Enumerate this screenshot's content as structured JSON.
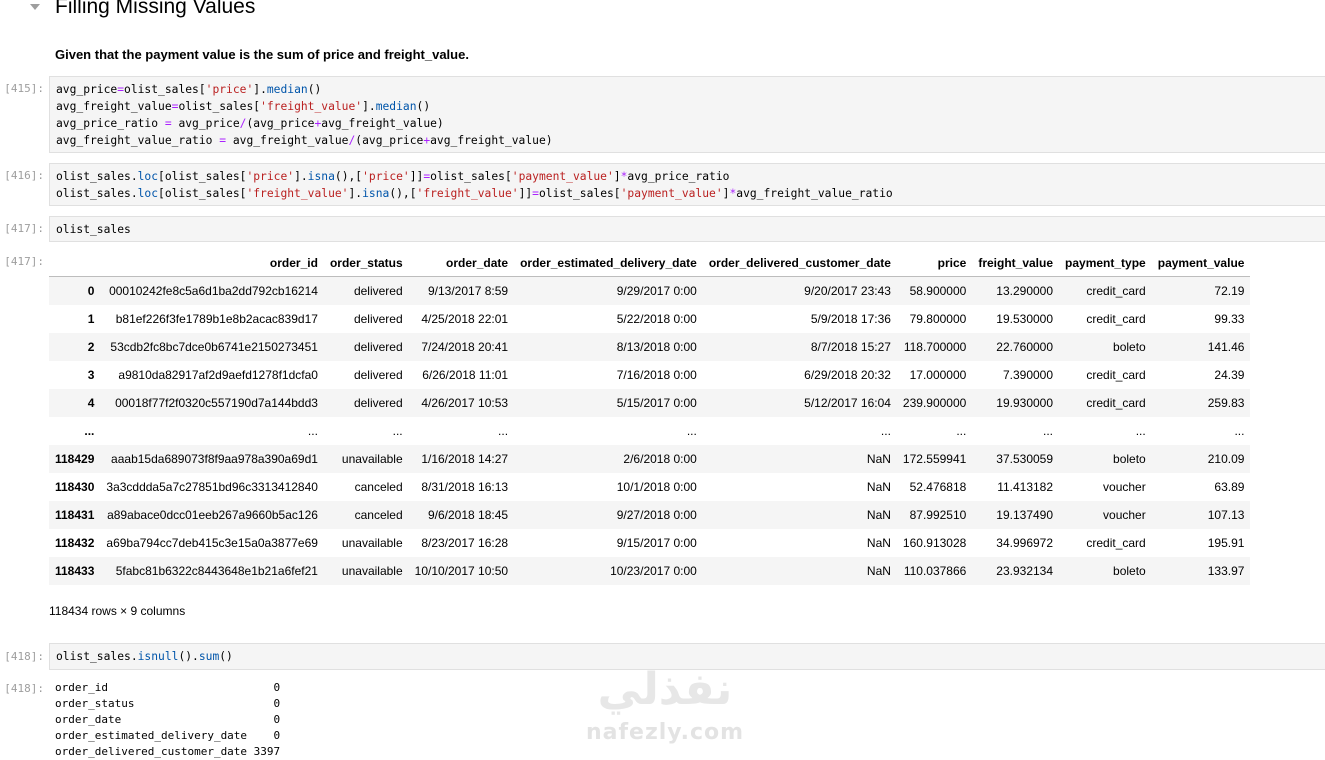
{
  "section": {
    "title": "Filling Missing Values",
    "description": "Given that the payment value is the sum of price and freight_value."
  },
  "cells": [
    {
      "prompt": "[415]:",
      "lines": [
        "avg_price=olist_sales['price'].median()",
        "avg_freight_value=olist_sales['freight_value'].median()",
        "avg_price_ratio = avg_price/(avg_price+avg_freight_value)",
        "avg_freight_value_ratio = avg_freight_value/(avg_price+avg_freight_value)"
      ]
    },
    {
      "prompt": "[416]:",
      "lines": [
        "olist_sales.loc[olist_sales['price'].isna(),['price']]=olist_sales['payment_value']*avg_price_ratio",
        "olist_sales.loc[olist_sales['freight_value'].isna(),['freight_value']]=olist_sales['payment_value']*avg_freight_value_ratio"
      ]
    },
    {
      "prompt": "[417]:",
      "lines": [
        "olist_sales"
      ]
    },
    {
      "prompt": "[418]:",
      "lines": [
        "olist_sales.isnull().sum()"
      ]
    }
  ],
  "output_417": {
    "prompt": "[417]:",
    "columns": [
      "",
      "order_id",
      "order_status",
      "order_date",
      "order_estimated_delivery_date",
      "order_delivered_customer_date",
      "price",
      "freight_value",
      "payment_type",
      "payment_value"
    ],
    "rows": [
      [
        "0",
        "00010242fe8c5a6d1ba2dd792cb16214",
        "delivered",
        "9/13/2017 8:59",
        "9/29/2017 0:00",
        "9/20/2017 23:43",
        "58.900000",
        "13.290000",
        "credit_card",
        "72.19"
      ],
      [
        "1",
        "b81ef226f3fe1789b1e8b2acac839d17",
        "delivered",
        "4/25/2018 22:01",
        "5/22/2018 0:00",
        "5/9/2018 17:36",
        "79.800000",
        "19.530000",
        "credit_card",
        "99.33"
      ],
      [
        "2",
        "53cdb2fc8bc7dce0b6741e2150273451",
        "delivered",
        "7/24/2018 20:41",
        "8/13/2018 0:00",
        "8/7/2018 15:27",
        "118.700000",
        "22.760000",
        "boleto",
        "141.46"
      ],
      [
        "3",
        "a9810da82917af2d9aefd1278f1dcfa0",
        "delivered",
        "6/26/2018 11:01",
        "7/16/2018 0:00",
        "6/29/2018 20:32",
        "17.000000",
        "7.390000",
        "credit_card",
        "24.39"
      ],
      [
        "4",
        "00018f77f2f0320c557190d7a144bdd3",
        "delivered",
        "4/26/2017 10:53",
        "5/15/2017 0:00",
        "5/12/2017 16:04",
        "239.900000",
        "19.930000",
        "credit_card",
        "259.83"
      ],
      [
        "...",
        "...",
        "...",
        "...",
        "...",
        "...",
        "...",
        "...",
        "...",
        "..."
      ],
      [
        "118429",
        "aaab15da689073f8f9aa978a390a69d1",
        "unavailable",
        "1/16/2018 14:27",
        "2/6/2018 0:00",
        "NaN",
        "172.559941",
        "37.530059",
        "boleto",
        "210.09"
      ],
      [
        "118430",
        "3a3cddda5a7c27851bd96c3313412840",
        "canceled",
        "8/31/2018 16:13",
        "10/1/2018 0:00",
        "NaN",
        "52.476818",
        "11.413182",
        "voucher",
        "63.89"
      ],
      [
        "118431",
        "a89abace0dcc01eeb267a9660b5ac126",
        "canceled",
        "9/6/2018 18:45",
        "9/27/2018 0:00",
        "NaN",
        "87.992510",
        "19.137490",
        "voucher",
        "107.13"
      ],
      [
        "118432",
        "a69ba794cc7deb415c3e15a0a3877e69",
        "unavailable",
        "8/23/2017 16:28",
        "9/15/2017 0:00",
        "NaN",
        "160.913028",
        "34.996972",
        "credit_card",
        "195.91"
      ],
      [
        "118433",
        "5fabc81b6322c8443648e1b21a6fef21",
        "unavailable",
        "10/10/2017 10:50",
        "10/23/2017 0:00",
        "NaN",
        "110.037866",
        "23.932134",
        "boleto",
        "133.97"
      ]
    ],
    "shape": "118434 rows × 9 columns"
  },
  "output_418": {
    "prompt": "[418]:",
    "items": [
      [
        "order_id",
        "0"
      ],
      [
        "order_status",
        "0"
      ],
      [
        "order_date",
        "0"
      ],
      [
        "order_estimated_delivery_date",
        "0"
      ],
      [
        "order_delivered_customer_date",
        "3397"
      ]
    ]
  },
  "watermark": {
    "arabic": "نفذلي",
    "latin": "nafezly.com"
  },
  "colors": {
    "string": "#ba2121",
    "function": "#0055aa",
    "operator": "#aa22ff",
    "cell_background": "#f5f5f5",
    "prompt": "#9e9e9e"
  }
}
